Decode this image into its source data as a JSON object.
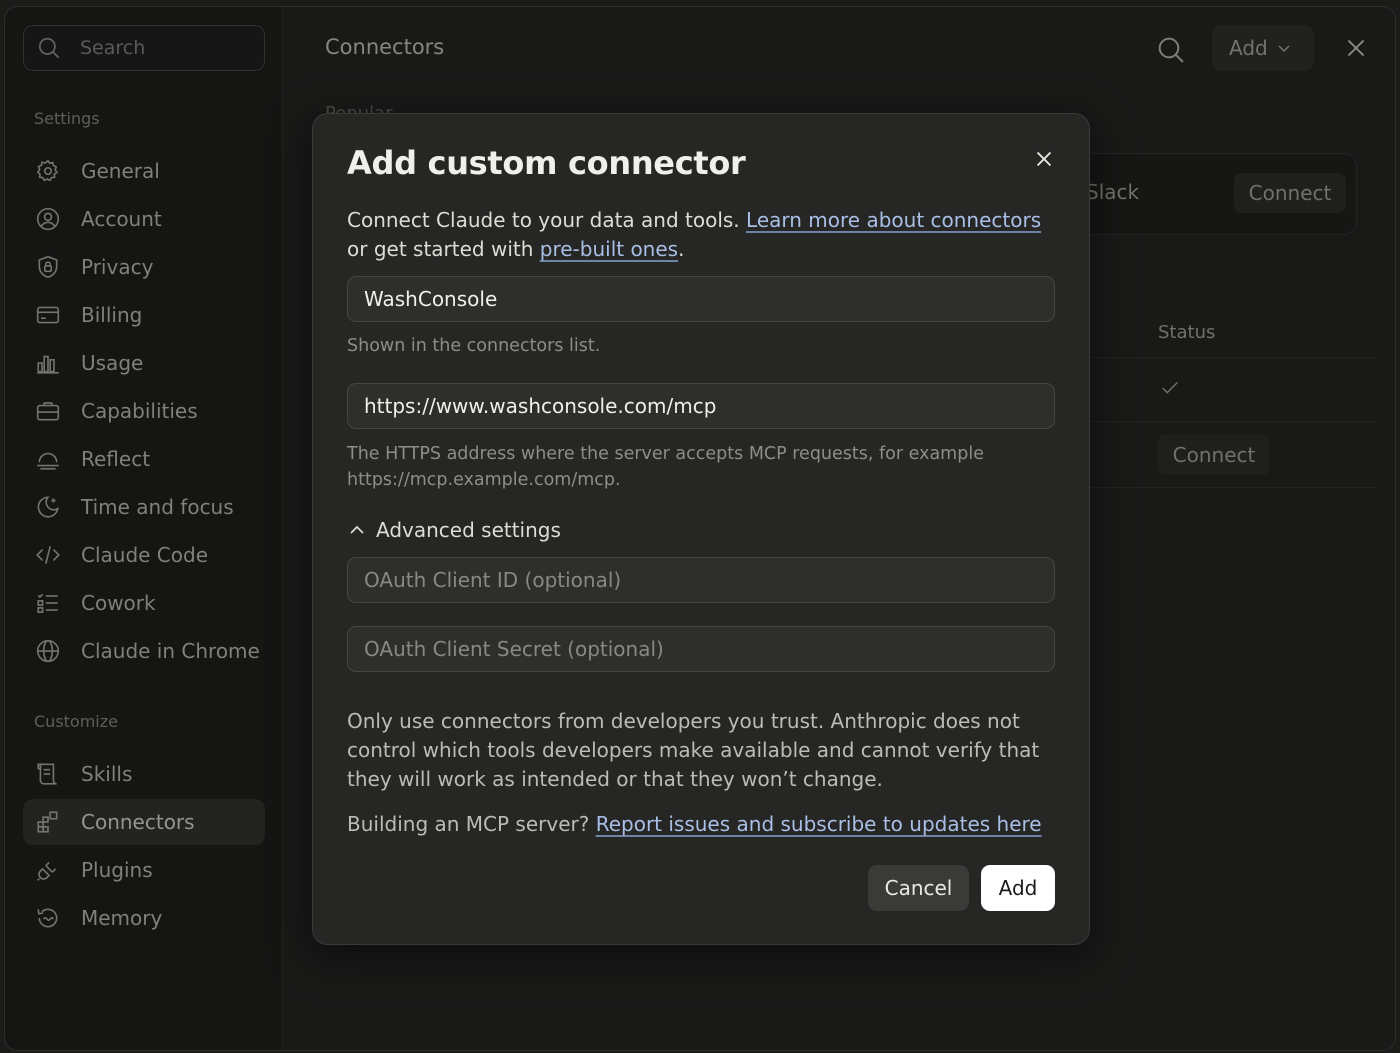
{
  "sidebar": {
    "search_placeholder": "Search",
    "settings_label": "Settings",
    "customize_label": "Customize",
    "settings_items": [
      {
        "label": "General",
        "icon": "gear-icon"
      },
      {
        "label": "Account",
        "icon": "user-circle-icon"
      },
      {
        "label": "Privacy",
        "icon": "shield-lock-icon"
      },
      {
        "label": "Billing",
        "icon": "credit-card-icon"
      },
      {
        "label": "Usage",
        "icon": "bar-chart-icon"
      },
      {
        "label": "Capabilities",
        "icon": "briefcase-icon"
      },
      {
        "label": "Reflect",
        "icon": "sunrise-icon"
      },
      {
        "label": "Time and focus",
        "icon": "moon-icon"
      },
      {
        "label": "Claude Code",
        "icon": "code-icon"
      },
      {
        "label": "Cowork",
        "icon": "checklist-icon"
      },
      {
        "label": "Claude in Chrome",
        "icon": "globe-icon"
      }
    ],
    "customize_items": [
      {
        "label": "Skills",
        "icon": "scroll-icon"
      },
      {
        "label": "Connectors",
        "icon": "grid-plus-icon",
        "active": true
      },
      {
        "label": "Plugins",
        "icon": "plug-icon"
      },
      {
        "label": "Memory",
        "icon": "history-icon"
      }
    ]
  },
  "main": {
    "title": "Connectors",
    "add_label": "Add",
    "popular_label": "Popular",
    "slack_name": "Slack",
    "slack_connect": "Connect",
    "status_header": "Status",
    "row_connect": "Connect"
  },
  "modal": {
    "title": "Add custom connector",
    "intro_text": "Connect Claude to your data and tools.",
    "intro_link1": "Learn more about connectors",
    "intro_or": "or",
    "intro_text2": "get started with",
    "intro_link2": "pre-built ones",
    "name_value": "WashConsole",
    "name_helper": "Shown in the connectors list.",
    "url_value": "https://www.washconsole.com/mcp",
    "url_helper": "The HTTPS address where the server accepts MCP requests, for example https://mcp.example.com/mcp.",
    "advanced_label": "Advanced settings",
    "client_id_placeholder": "OAuth Client ID (optional)",
    "client_secret_placeholder": "OAuth Client Secret (optional)",
    "warning": "Only use connectors from developers you trust. Anthropic does not control which tools developers make available and cannot verify that they will work as intended or that they won’t change.",
    "building_text": "Building an MCP server?",
    "building_link": "Report issues and subscribe to updates here",
    "cancel_label": "Cancel",
    "add_label": "Add"
  }
}
